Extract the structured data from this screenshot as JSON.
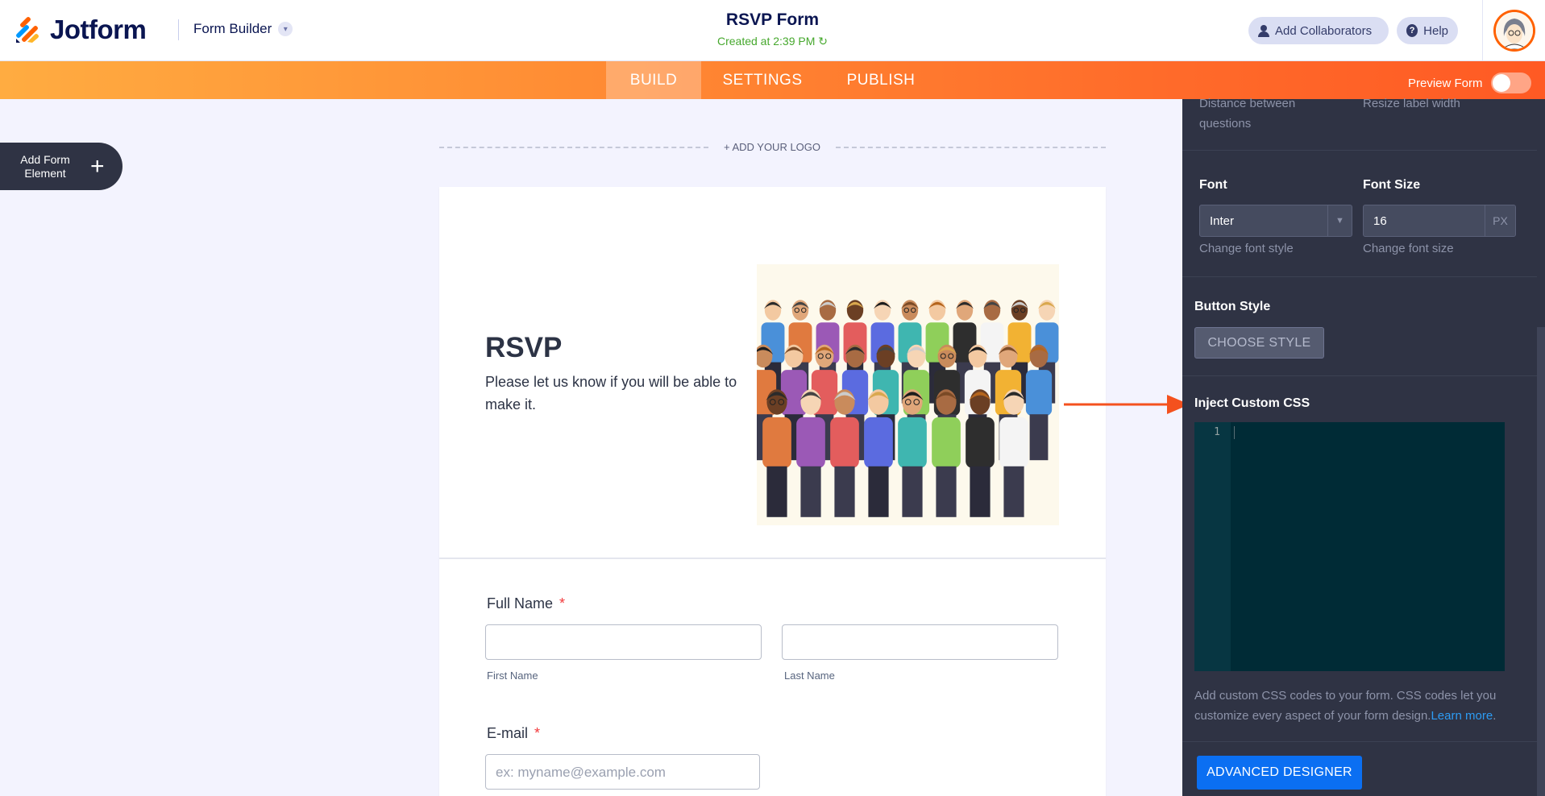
{
  "header": {
    "brand": "Jotform",
    "mode_label": "Form Builder",
    "form_title": "RSVP Form",
    "created": "Created at 2:39 PM",
    "collab_label": "Add Collaborators",
    "help_label": "Help"
  },
  "nav": {
    "tabs": [
      {
        "label": "BUILD",
        "active": true
      },
      {
        "label": "SETTINGS",
        "active": false
      },
      {
        "label": "PUBLISH",
        "active": false
      }
    ],
    "preview_label": "Preview Form",
    "preview_on": false
  },
  "builder": {
    "add_element_label": "Add Form Element",
    "add_logo_label": "+ ADD YOUR LOGO"
  },
  "form": {
    "heading": "RSVP",
    "subheading": "Please let us know if you will be able to make it.",
    "fields": {
      "full_name": {
        "label": "Full Name",
        "required_mark": "*",
        "first_sub": "First Name",
        "last_sub": "Last Name"
      },
      "email": {
        "label": "E-mail",
        "required_mark": "*",
        "placeholder": "ex: myname@example.com"
      }
    }
  },
  "panel": {
    "spacing_hint_left": "Distance between questions",
    "spacing_hint_right": "Resize label width",
    "font_title": "Font",
    "font_value": "Inter",
    "font_hint": "Change font style",
    "font_size_title": "Font Size",
    "font_size_value": "16",
    "font_size_unit": "PX",
    "font_size_hint": "Change font size",
    "button_style_title": "Button Style",
    "choose_style_label": "CHOOSE STYLE",
    "custom_css_title": "Inject Custom CSS",
    "editor_line": "1",
    "css_help": "Add custom CSS codes to your form. CSS codes let you customize every aspect of your form design.",
    "learn_more": "Learn more",
    "learn_more_suffix": ".",
    "advanced_label": "ADVANCED DESIGNER"
  },
  "colors": {
    "accent_orange": "#ff6100",
    "panel_bg": "#2f3344",
    "primary_blue": "#0b6ff2",
    "annotation_arrow": "#f4511e"
  }
}
